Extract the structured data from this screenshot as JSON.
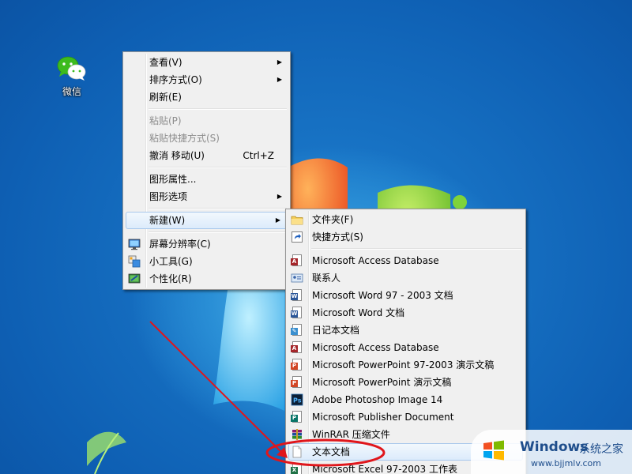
{
  "desktop": {
    "icons": [
      {
        "label": "微信",
        "icon": "wechat-icon"
      }
    ]
  },
  "context_menu": {
    "items": [
      {
        "label": "查看(V)",
        "submenu": true
      },
      {
        "label": "排序方式(O)",
        "submenu": true
      },
      {
        "label": "刷新(E)"
      },
      {
        "label": "粘贴(P)",
        "disabled": true
      },
      {
        "label": "粘贴快捷方式(S)",
        "disabled": true
      },
      {
        "label": "撤消 移动(U)",
        "shortcut": "Ctrl+Z"
      },
      {
        "label": "图形属性..."
      },
      {
        "label": "图形选项",
        "submenu": true
      },
      {
        "label": "新建(W)",
        "submenu": true,
        "highlighted": true
      },
      {
        "label": "屏幕分辨率(C)",
        "icon": "screen-resolution-icon"
      },
      {
        "label": "小工具(G)",
        "icon": "gadgets-icon"
      },
      {
        "label": "个性化(R)",
        "icon": "personalize-icon"
      }
    ],
    "arrow_glyph": "▶"
  },
  "new_submenu": {
    "items": [
      {
        "label": "文件夹(F)",
        "icon": "folder-icon"
      },
      {
        "label": "快捷方式(S)",
        "icon": "shortcut-icon"
      },
      {
        "label": "Microsoft Access Database",
        "icon": "access-icon"
      },
      {
        "label": "联系人",
        "icon": "contact-icon"
      },
      {
        "label": "Microsoft Word 97 - 2003 文档",
        "icon": "word-icon"
      },
      {
        "label": "Microsoft Word 文档",
        "icon": "word-icon"
      },
      {
        "label": "日记本文档",
        "icon": "journal-icon"
      },
      {
        "label": "Microsoft Access Database",
        "icon": "access-icon"
      },
      {
        "label": "Microsoft PowerPoint 97-2003 演示文稿",
        "icon": "powerpoint-icon"
      },
      {
        "label": "Microsoft PowerPoint 演示文稿",
        "icon": "powerpoint-icon"
      },
      {
        "label": "Adobe Photoshop Image 14",
        "icon": "photoshop-icon"
      },
      {
        "label": "Microsoft Publisher Document",
        "icon": "publisher-icon"
      },
      {
        "label": "WinRAR 压缩文件",
        "icon": "winrar-icon"
      },
      {
        "label": "文本文档",
        "icon": "text-document-icon",
        "highlighted": true
      },
      {
        "label": "Microsoft Excel 97-2003 工作表",
        "icon": "excel-icon"
      }
    ]
  },
  "watermark": {
    "title": "Windows",
    "title_cn": "系统之家",
    "url": "www.bjjmlv.com"
  },
  "colors": {
    "annotation_red": "#e0161b",
    "menu_highlight": "#dcebfb",
    "desktop_blue": "#0e5fb3"
  }
}
